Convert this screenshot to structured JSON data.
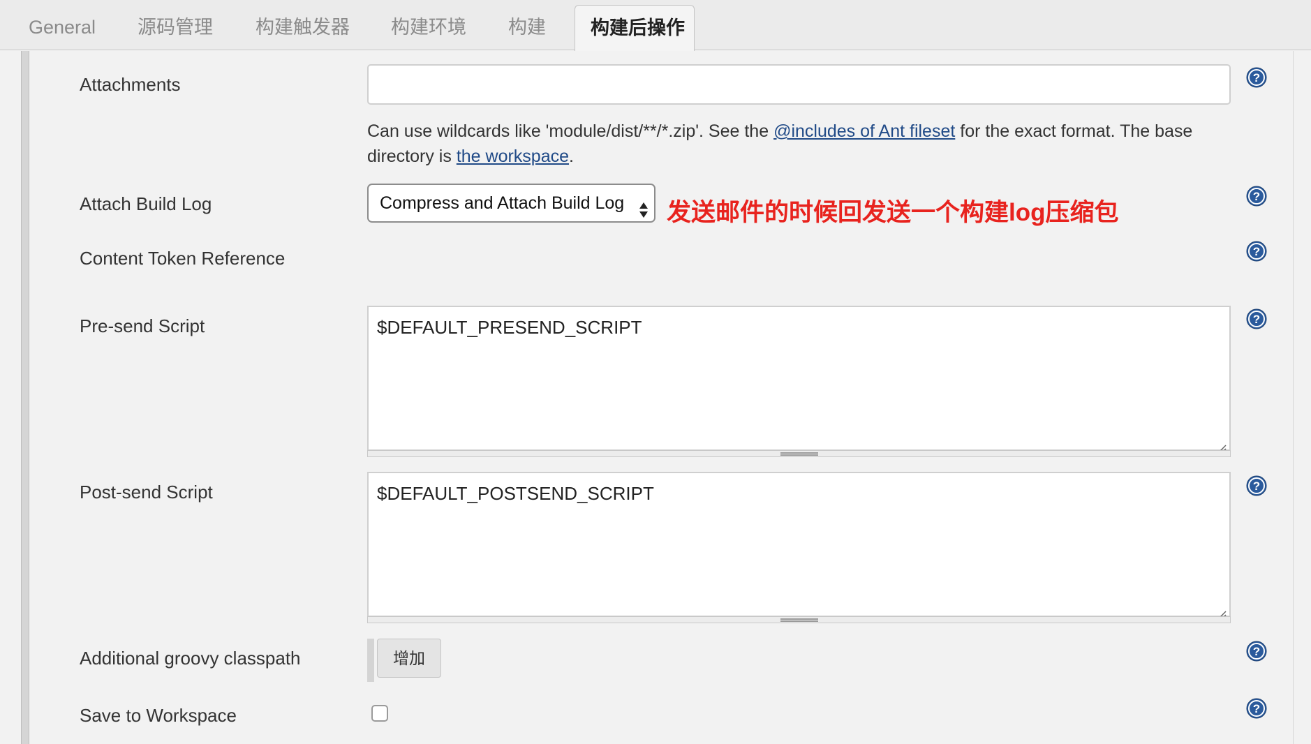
{
  "tabs": [
    {
      "label": "General"
    },
    {
      "label": "源码管理"
    },
    {
      "label": "构建触发器"
    },
    {
      "label": "构建环境"
    },
    {
      "label": "构建"
    },
    {
      "label": "构建后操作",
      "active": true
    }
  ],
  "fields": {
    "attachments": {
      "label": "Attachments",
      "value": "",
      "hint_prefix": "Can use wildcards like 'module/dist/**/*.zip'. See the ",
      "hint_link1": "@includes of Ant fileset",
      "hint_middle": " for the exact format. The base directory is ",
      "hint_link2": "the workspace",
      "hint_suffix": "."
    },
    "attach_build_log": {
      "label": "Attach Build Log",
      "selected": "Compress and Attach Build Log"
    },
    "content_token": {
      "label": "Content Token Reference"
    },
    "pre_send": {
      "label": "Pre-send Script",
      "value": "$DEFAULT_PRESEND_SCRIPT"
    },
    "post_send": {
      "label": "Post-send Script",
      "value": "$DEFAULT_POSTSEND_SCRIPT"
    },
    "groovy_classpath": {
      "label": "Additional groovy classpath",
      "button": "增加"
    },
    "save_workspace": {
      "label": "Save to Workspace",
      "checked": false
    }
  },
  "annotation": "发送邮件的时候回发送一个构建log压缩包",
  "colors": {
    "annotation": "#e8231e",
    "link": "#204a87",
    "help_icon": "#2a5a9c"
  },
  "icons": [
    "help-icon",
    "select-arrows-icon",
    "resize-handle-icon"
  ]
}
